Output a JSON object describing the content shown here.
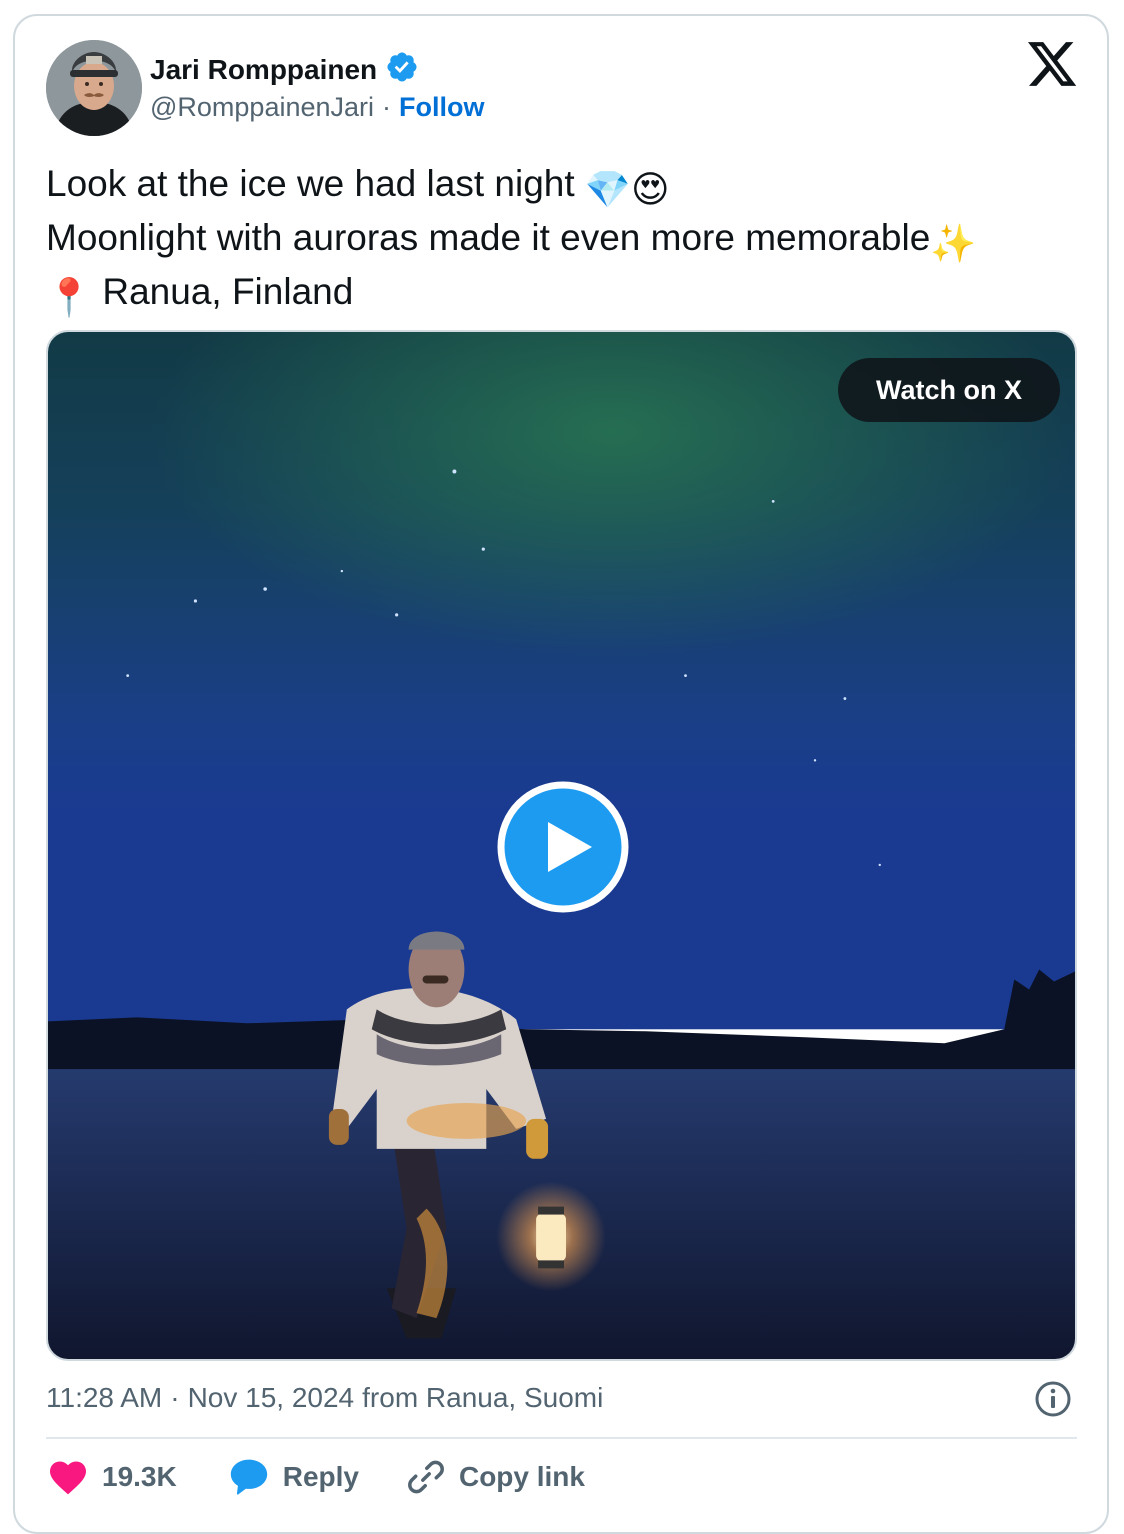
{
  "author": {
    "name": "Jari Romppainen",
    "handle": "@RomppainenJari",
    "separator": "·",
    "follow_label": "Follow"
  },
  "tweet": {
    "line1_text": "Look at the ice we had last night",
    "line1_emojis": "💎😍",
    "line2_text": "Moonlight with auroras made it even more memorable",
    "line2_emoji": "✨",
    "line3_emoji": "📍",
    "line3_text": "Ranua, Finland"
  },
  "media": {
    "watch_label": "Watch on X"
  },
  "meta": {
    "time": "11:28 AM",
    "separator": "·",
    "date": "Nov 15, 2024",
    "source": "from Ranua, Suomi"
  },
  "actions": {
    "likes_count": "19.3K",
    "reply_label": "Reply",
    "copy_label": "Copy link"
  },
  "colors": {
    "verified": "#1d9bf0",
    "follow": "#006fd6",
    "heart": "#f91880",
    "reply_bubble": "#1d9bf0",
    "muted_text": "#536471",
    "play_button": "#1d9bf0"
  },
  "icons": [
    "verified-badge-icon",
    "x-logo-icon",
    "play-icon",
    "info-icon",
    "heart-icon",
    "reply-bubble-icon",
    "link-icon"
  ]
}
